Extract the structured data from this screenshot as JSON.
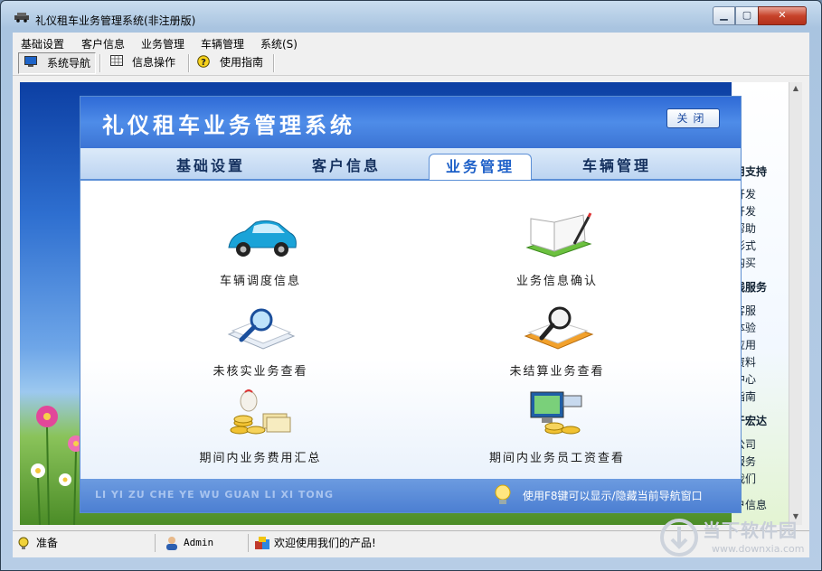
{
  "window": {
    "title": "礼仪租车业务管理系统(非注册版)"
  },
  "menubar": {
    "items": [
      "基础设置",
      "客户信息",
      "业务管理",
      "车辆管理",
      "系统(S)"
    ]
  },
  "toolbar": {
    "buttons": [
      "系统导航",
      "信息操作",
      "使用指南"
    ]
  },
  "right_panel": {
    "lines": [
      "用支持",
      "开发",
      "开发",
      "帮助",
      "形式",
      "购买",
      "线服务",
      "客服",
      "体验",
      "应用",
      "资料",
      "中心",
      "指南",
      "于宏达",
      "公司",
      "服务",
      "我们",
      "户信息"
    ]
  },
  "nav": {
    "title": "礼仪租车业务管理系统",
    "close_label": "关闭",
    "tabs": [
      "基础设置",
      "客户信息",
      "业务管理",
      "车辆管理"
    ],
    "active_tab": "业务管理",
    "tiles": [
      {
        "label": "车辆调度信息",
        "icon": "car-icon"
      },
      {
        "label": "业务信息确认",
        "icon": "book-pen-icon"
      },
      {
        "label": "未核实业务查看",
        "icon": "documents-magnifier-icon"
      },
      {
        "label": "未结算业务查看",
        "icon": "folder-magnifier-icon"
      },
      {
        "label": "期间内业务费用汇总",
        "icon": "coins-money-icon"
      },
      {
        "label": "期间内业务员工资查看",
        "icon": "monitor-coins-icon"
      }
    ],
    "footer_pinyin": "LI YI ZU CHE YE WU GUAN LI XI TONG",
    "footer_hint": "使用F8键可以显示/隐藏当前导航窗口"
  },
  "statusbar": {
    "ready": "准备",
    "user": "Admin",
    "welcome": "欢迎使用我们的产品!"
  },
  "watermark": {
    "text": "当下软件园",
    "url": "www.downxia.com"
  },
  "colors": {
    "accent": "#3c74d4",
    "header": "#2f6ad6",
    "footer": "#4c7fd2"
  }
}
